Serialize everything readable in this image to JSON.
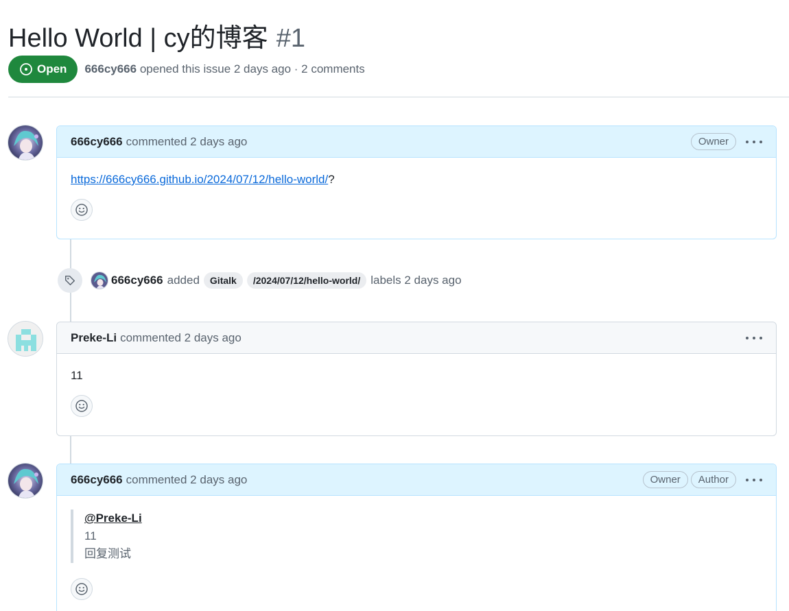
{
  "issue": {
    "title": "Hello World | cy的博客",
    "number": "#1",
    "state": "Open",
    "author": "666cy666",
    "meta_text": "opened this issue 2 days ago · 2 comments"
  },
  "comments": [
    {
      "author": "666cy666",
      "action": "commented 2 days ago",
      "badges": [
        "Owner"
      ],
      "body_link": "https://666cy666.github.io/2024/07/12/hello-world/",
      "body_suffix": "?"
    },
    {
      "author": "Preke-Li",
      "action": "commented 2 days ago",
      "badges": [],
      "body_text": "11"
    },
    {
      "author": "666cy666",
      "action": "commented 2 days ago",
      "badges": [
        "Owner",
        "Author"
      ],
      "quote": {
        "mention": "@Preke-Li",
        "lines": [
          "11",
          "回复测试"
        ]
      }
    }
  ],
  "event": {
    "author": "666cy666",
    "action": "added",
    "labels": [
      "Gitalk",
      "/2024/07/12/hello-world/"
    ],
    "suffix": "labels 2 days ago"
  },
  "icons": {
    "state": "issue-opened-icon",
    "tag": "tag-icon",
    "emoji": "smiley-icon",
    "menu": "kebab-horizontal-icon"
  },
  "colors": {
    "open_green": "#1f883d",
    "owner_header": "#ddf4ff",
    "owner_border": "#b6e3ff",
    "link": "#0969da"
  }
}
